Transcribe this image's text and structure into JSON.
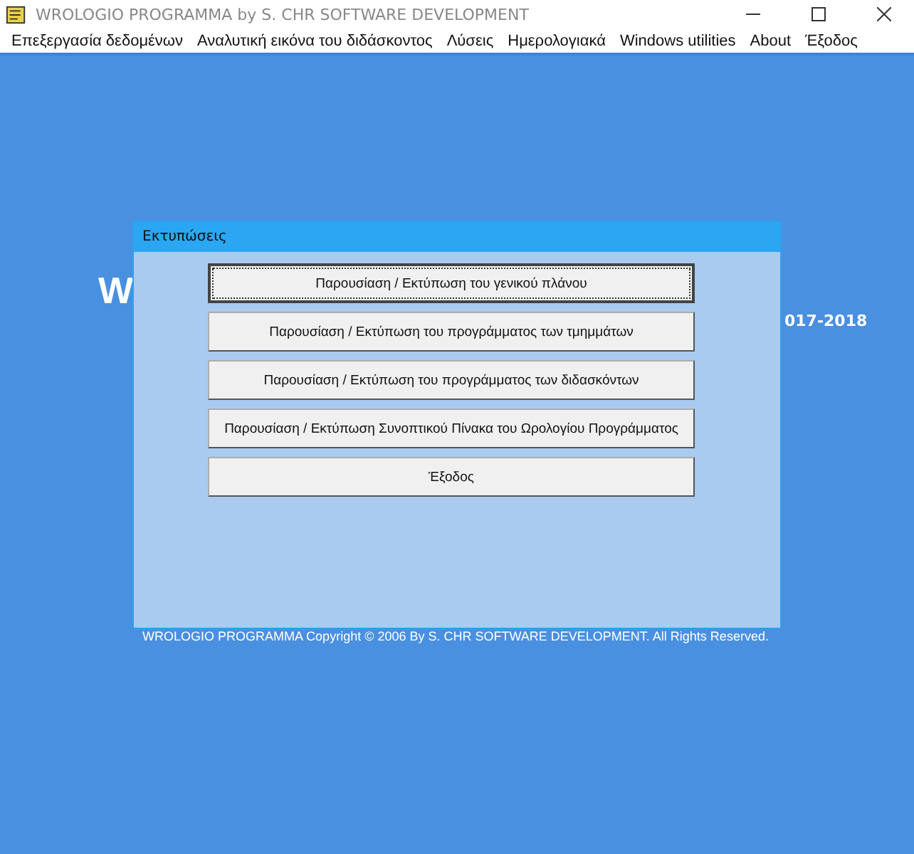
{
  "window": {
    "title": "WROLOGIO PROGRAMMA by S. CHR SOFTWARE DEVELOPMENT"
  },
  "menu": [
    "Επεξεργασία δεδομένων",
    "Αναλυτική εικόνα του διδάσκοντος",
    "Λύσεις",
    "Ημερολογιακά",
    "Windows utilities",
    "About",
    "Έξοδος"
  ],
  "background": {
    "heading_start": "W",
    "year": "017-2018",
    "copyright": "WROLOGIO PROGRAMMA Copyright © 2006 By S. CHR SOFTWARE DEVELOPMENT. All Rights Reserved."
  },
  "dialog": {
    "title": "Εκτυπώσεις",
    "buttons": [
      {
        "label": "Παρουσίαση / Εκτύπωση του γενικού πλάνου",
        "selected": true
      },
      {
        "label": "Παρουσίαση / Εκτύπωση του προγράμματος των τμημμάτων",
        "selected": false
      },
      {
        "label": "Παρουσίαση / Εκτύπωση του προγράμματος των διδασκόντων",
        "selected": false
      },
      {
        "label": "Παρουσίαση / Εκτύπωση Συνοπτικού Πίνακα του Ωρολογίου Προγράμματος",
        "selected": false
      },
      {
        "label": "Έξοδος",
        "selected": false
      }
    ]
  }
}
